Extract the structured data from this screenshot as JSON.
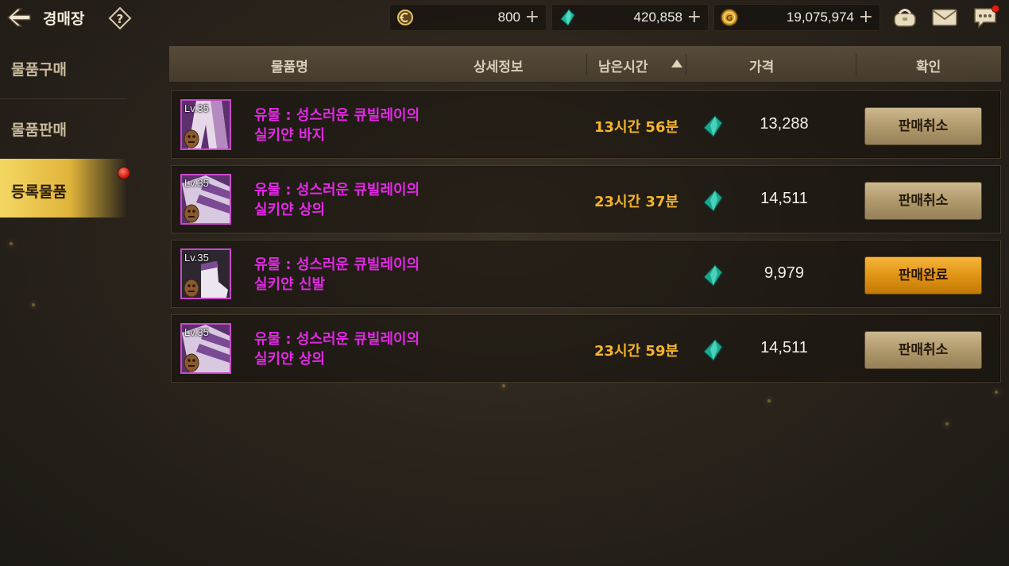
{
  "header": {
    "title": "경매장",
    "currencies": [
      {
        "icon": "crest-currency-icon",
        "value": "800"
      },
      {
        "icon": "teal-gem-icon",
        "value": "420,858"
      },
      {
        "icon": "gold-coin-icon",
        "value": "19,075,974"
      }
    ],
    "plus_glyph": "+",
    "help_glyph": "?"
  },
  "sidebar": {
    "items": [
      {
        "label": "물품구매"
      },
      {
        "label": "물품판매"
      },
      {
        "label": "등록물품",
        "selected": true
      }
    ]
  },
  "table": {
    "columns": [
      "물품명",
      "상세정보",
      "남은시간",
      "가격",
      "확인"
    ],
    "sort_column": "남은시간",
    "sort_direction": "ascending",
    "rows": [
      {
        "level": "Lv.35",
        "name_line1": "유물 : 성스러운 큐빌레이의",
        "name_line2": "실키얀 바지",
        "time": "13시간 56분",
        "price": "13,288",
        "action": "판매취소"
      },
      {
        "level": "Lv.35",
        "name_line1": "유물 : 성스러운 큐빌레이의",
        "name_line2": "실키얀 상의",
        "time": "23시간 37분",
        "price": "14,511",
        "action": "판매취소"
      },
      {
        "level": "Lv.35",
        "name_line1": "유물 : 성스러운 큐빌레이의",
        "name_line2": "실키얀 신발",
        "time": "",
        "price": "9,979",
        "action": "판매완료"
      },
      {
        "level": "Lv.35",
        "name_line1": "유물 : 성스러운 큐빌레이의",
        "name_line2": "실키얀 상의",
        "time": "23시간 59분",
        "price": "14,511",
        "action": "판매취소"
      }
    ]
  },
  "colors": {
    "item_name": "#e328e6",
    "time_text": "#f4b42c",
    "selected_tab": "#f4d763",
    "cancel_button": "#b8a274",
    "complete_button": "#e8990f"
  }
}
